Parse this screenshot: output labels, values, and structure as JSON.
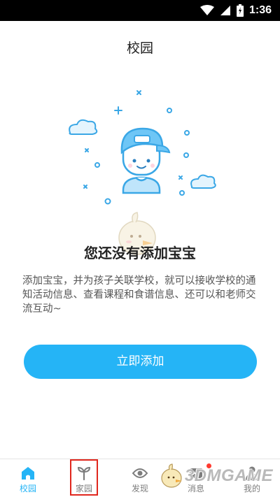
{
  "status_bar": {
    "time": "1:36",
    "icons": [
      "wifi-icon",
      "signal-icon",
      "battery-icon"
    ]
  },
  "header": {
    "title": "校园"
  },
  "empty_state": {
    "title": "您还没有添加宝宝",
    "description": "添加宝宝，并为孩子关联学校，就可以接收学校的通知活动信息、查看课程和食谱信息、还可以和老师交流互动~",
    "illustration": "child-with-cap-illustration"
  },
  "actions": {
    "add_button": "立即添加"
  },
  "tabbar": {
    "tabs": [
      {
        "label": "校园",
        "icon": "school-icon",
        "active": true
      },
      {
        "label": "家园",
        "icon": "sprout-icon",
        "active": false
      },
      {
        "label": "发现",
        "icon": "eye-icon",
        "active": false
      },
      {
        "label": "消息",
        "icon": "mail-icon",
        "active": false,
        "badge": true
      },
      {
        "label": "我的",
        "icon": "person-icon",
        "active": false
      }
    ]
  },
  "watermark": {
    "text": "3DMGAME"
  },
  "colors": {
    "accent": "#25b4f6",
    "highlight_box": "#e0271d",
    "badge": "#ff3b30"
  }
}
